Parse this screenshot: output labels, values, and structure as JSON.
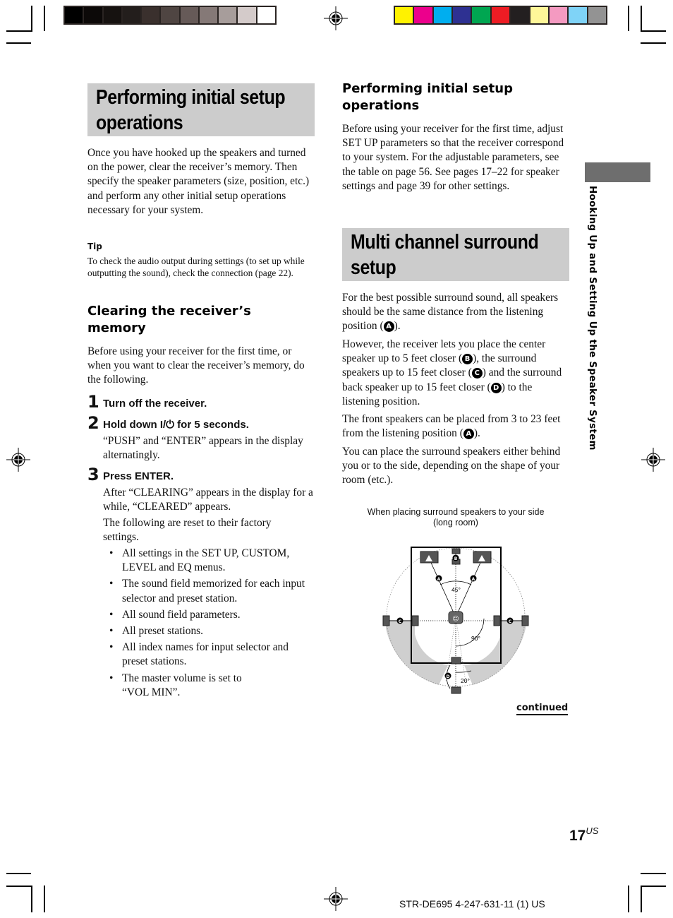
{
  "print_marks": {
    "gray_swatches": [
      "#000000",
      "#0c0908",
      "#161210",
      "#231e1c",
      "#3a302d",
      "#4f4542",
      "#665a58",
      "#857977",
      "#a79d9b",
      "#d4cbca",
      "#ffffff"
    ],
    "color_swatches": [
      "#fff200",
      "#ec008c",
      "#00aeef",
      "#2e3192",
      "#00a651",
      "#ed1c24",
      "#231f20",
      "#fff799",
      "#f49ac1",
      "#7fd3f7",
      "#939393"
    ]
  },
  "left_column": {
    "section_title": "Performing initial setup operations",
    "intro": "Once you have hooked up the speakers and turned on the power, clear the receiver’s memory. Then specify the speaker parameters (size, position, etc.) and perform any other initial setup operations necessary for your system.",
    "tip_label": "Tip",
    "tip_text": "To check the audio output during settings (to set up while outputting the sound), check the connection (page 22).",
    "subheading": "Clearing the receiver’s memory",
    "sub_intro": "Before using your receiver for the first time, or when you want to clear the receiver’s memory, do the following.",
    "steps": [
      {
        "number": "1",
        "title": "Turn off the receiver.",
        "body": []
      },
      {
        "number": "2",
        "title": "Hold down I/⏻ for 5 seconds.",
        "body": [
          "“PUSH” and “ENTER” appears in the display alternatingly."
        ]
      },
      {
        "number": "3",
        "title": "Press ENTER.",
        "body": [
          "After “CLEARING” appears in the display for a while, “CLEARED” appears.",
          "The following are reset to their factory settings."
        ]
      }
    ],
    "reset_items": [
      "All settings in the SET UP, CUSTOM, LEVEL and EQ menus.",
      "The sound field memorized for each input selector and preset station.",
      "All sound field parameters.",
      "All preset stations.",
      "All index names for input selector and preset stations.",
      "The master volume is set to “VOL MIN”."
    ]
  },
  "right_column": {
    "subheading": "Performing initial setup operations",
    "intro": "Before using your receiver for the first time, adjust SET UP parameters so that the receiver correspond to your system. For the adjustable parameters, see the table on page 56. See pages 17–22 for speaker settings and page 39 for other settings.",
    "section_title": "Multi channel surround setup",
    "para1_a": "For the best possible surround sound, all speakers should be the same distance from the listening position (",
    "para1_b": ").",
    "para2_a": "However, the receiver lets you place the center speaker up to 5 feet closer (",
    "para2_b": "), the surround speakers up to 15 feet closer (",
    "para2_c": ") and the surround back speaker up to 15 feet closer (",
    "para2_d": ") to the listening position.",
    "para3_a": "The front speakers can be placed from 3 to 23 feet from the listening position (",
    "para3_b": ").",
    "para4": "You can place the surround speakers either behind you or to the side, depending on the shape of your room (etc.).",
    "markers": {
      "A": "A",
      "B": "B",
      "C": "C",
      "D": "D"
    },
    "diagram": {
      "caption_line1": "When placing surround speakers to your side",
      "caption_line2": "(long room)",
      "angle_front": "45°",
      "angle_side": "90°",
      "angle_back": "20°"
    },
    "continued": "continued"
  },
  "side_tab": {
    "label": "Hooking Up and Setting Up the Speaker System"
  },
  "page": {
    "number": "17",
    "region": "US"
  },
  "footer": {
    "code": "STR-DE695 4-247-631-11 (1) US"
  }
}
